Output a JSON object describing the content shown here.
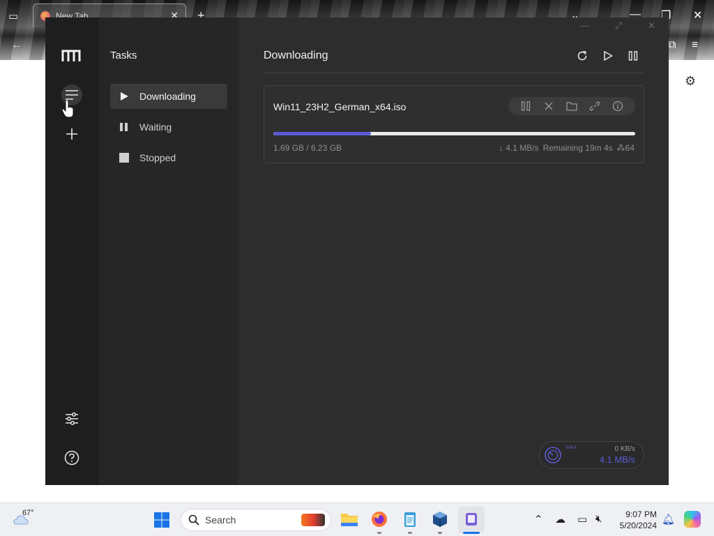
{
  "browser": {
    "tab_title": "New Tab",
    "close_tab": "✕",
    "new_tab": "+"
  },
  "app": {
    "tasks_title": "Tasks",
    "task_items": [
      {
        "label": "Downloading",
        "icon": "play-icon"
      },
      {
        "label": "Waiting",
        "icon": "pause-icon"
      },
      {
        "label": "Stopped",
        "icon": "stop-icon"
      }
    ],
    "main_title": "Downloading",
    "download": {
      "filename": "Win11_23H2_German_x64.iso",
      "size": "1.69 GB / 6.23 GB",
      "speed": "↓ 4.1 MB/s",
      "remaining": "Remaining 19m 4s",
      "connections": "64",
      "progress_fraction": 0.27
    },
    "speed_widget": {
      "max_label": "MAX",
      "upload": "0 KB/s",
      "download": "4.1 MB/s"
    },
    "accent_color": "#5b5bd6"
  },
  "taskbar": {
    "temperature": "67°",
    "search_placeholder": "Search",
    "time": "9:07 PM",
    "date": "5/20/2024"
  }
}
